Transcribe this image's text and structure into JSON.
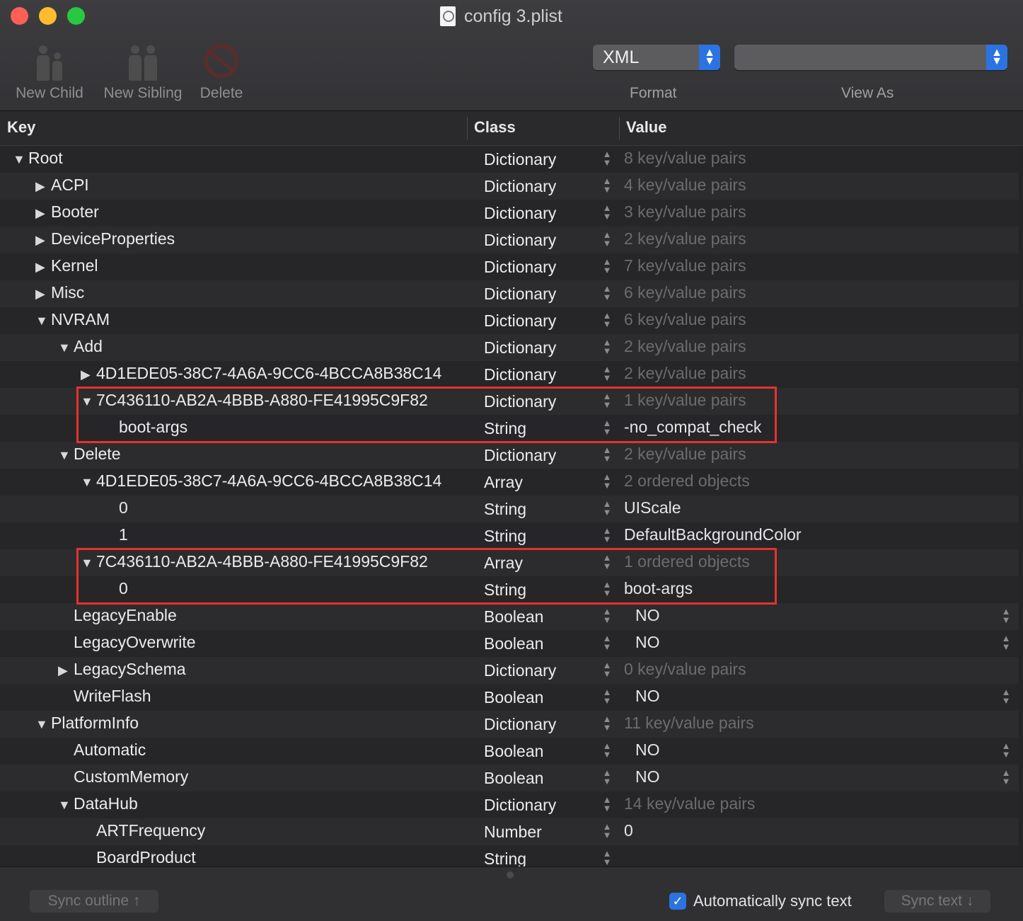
{
  "window": {
    "title": "config 3.plist"
  },
  "toolbar": {
    "new_child": "New Child",
    "new_sibling": "New Sibling",
    "delete": "Delete",
    "format_value": "XML",
    "format_label": "Format",
    "view_as_value": "",
    "view_as_label": "View As"
  },
  "columns": {
    "key": "Key",
    "class": "Class",
    "value": "Value"
  },
  "rows": [
    {
      "key": "Root",
      "depth": 0,
      "disclosure": "open",
      "class": "Dictionary",
      "value": "8 key/value pairs",
      "value_kind": "summary"
    },
    {
      "key": "ACPI",
      "depth": 1,
      "disclosure": "closed",
      "class": "Dictionary",
      "value": "4 key/value pairs",
      "value_kind": "summary"
    },
    {
      "key": "Booter",
      "depth": 1,
      "disclosure": "closed",
      "class": "Dictionary",
      "value": "3 key/value pairs",
      "value_kind": "summary"
    },
    {
      "key": "DeviceProperties",
      "depth": 1,
      "disclosure": "closed",
      "class": "Dictionary",
      "value": "2 key/value pairs",
      "value_kind": "summary"
    },
    {
      "key": "Kernel",
      "depth": 1,
      "disclosure": "closed",
      "class": "Dictionary",
      "value": "7 key/value pairs",
      "value_kind": "summary"
    },
    {
      "key": "Misc",
      "depth": 1,
      "disclosure": "closed",
      "class": "Dictionary",
      "value": "6 key/value pairs",
      "value_kind": "summary"
    },
    {
      "key": "NVRAM",
      "depth": 1,
      "disclosure": "open",
      "class": "Dictionary",
      "value": "6 key/value pairs",
      "value_kind": "summary"
    },
    {
      "key": "Add",
      "depth": 2,
      "disclosure": "open",
      "class": "Dictionary",
      "value": "2 key/value pairs",
      "value_kind": "summary"
    },
    {
      "key": "4D1EDE05-38C7-4A6A-9CC6-4BCCA8B38C14",
      "depth": 3,
      "disclosure": "closed",
      "class": "Dictionary",
      "value": "2 key/value pairs",
      "value_kind": "summary"
    },
    {
      "key": "7C436110-AB2A-4BBB-A880-FE41995C9F82",
      "depth": 3,
      "disclosure": "open",
      "class": "Dictionary",
      "value": "1 key/value pairs",
      "value_kind": "summary"
    },
    {
      "key": "boot-args",
      "depth": 4,
      "disclosure": "none",
      "class": "String",
      "value": "-no_compat_check",
      "value_kind": "text"
    },
    {
      "key": "Delete",
      "depth": 2,
      "disclosure": "open",
      "class": "Dictionary",
      "value": "2 key/value pairs",
      "value_kind": "summary"
    },
    {
      "key": "4D1EDE05-38C7-4A6A-9CC6-4BCCA8B38C14",
      "depth": 3,
      "disclosure": "open",
      "class": "Array",
      "value": "2 ordered objects",
      "value_kind": "summary"
    },
    {
      "key": "0",
      "depth": 4,
      "disclosure": "none",
      "class": "String",
      "value": "UIScale",
      "value_kind": "text"
    },
    {
      "key": "1",
      "depth": 4,
      "disclosure": "none",
      "class": "String",
      "value": "DefaultBackgroundColor",
      "value_kind": "text"
    },
    {
      "key": "7C436110-AB2A-4BBB-A880-FE41995C9F82",
      "depth": 3,
      "disclosure": "open",
      "class": "Array",
      "value": "1 ordered objects",
      "value_kind": "summary"
    },
    {
      "key": "0",
      "depth": 4,
      "disclosure": "none",
      "class": "String",
      "value": "boot-args",
      "value_kind": "text"
    },
    {
      "key": "LegacyEnable",
      "depth": 2,
      "disclosure": "none",
      "class": "Boolean",
      "value": "NO",
      "value_kind": "bool"
    },
    {
      "key": "LegacyOverwrite",
      "depth": 2,
      "disclosure": "none",
      "class": "Boolean",
      "value": "NO",
      "value_kind": "bool"
    },
    {
      "key": "LegacySchema",
      "depth": 2,
      "disclosure": "closed",
      "class": "Dictionary",
      "value": "0 key/value pairs",
      "value_kind": "summary"
    },
    {
      "key": "WriteFlash",
      "depth": 2,
      "disclosure": "none",
      "class": "Boolean",
      "value": "NO",
      "value_kind": "bool"
    },
    {
      "key": "PlatformInfo",
      "depth": 1,
      "disclosure": "open",
      "class": "Dictionary",
      "value": "11 key/value pairs",
      "value_kind": "summary"
    },
    {
      "key": "Automatic",
      "depth": 2,
      "disclosure": "none",
      "class": "Boolean",
      "value": "NO",
      "value_kind": "bool"
    },
    {
      "key": "CustomMemory",
      "depth": 2,
      "disclosure": "none",
      "class": "Boolean",
      "value": "NO",
      "value_kind": "bool"
    },
    {
      "key": "DataHub",
      "depth": 2,
      "disclosure": "open",
      "class": "Dictionary",
      "value": "14 key/value pairs",
      "value_kind": "summary"
    },
    {
      "key": "ARTFrequency",
      "depth": 3,
      "disclosure": "none",
      "class": "Number",
      "value": "0",
      "value_kind": "text"
    },
    {
      "key": "BoardProduct",
      "depth": 3,
      "disclosure": "none",
      "class": "String",
      "value": "",
      "value_kind": "text"
    }
  ],
  "highlighted_row_groups": [
    [
      9,
      10
    ],
    [
      15,
      16
    ]
  ],
  "highlight_color": "#e5322d",
  "footer": {
    "sync_outline": "Sync outline ↑",
    "auto_sync_label": "Automatically sync text",
    "auto_sync_checked": true,
    "sync_text": "Sync text ↓"
  }
}
